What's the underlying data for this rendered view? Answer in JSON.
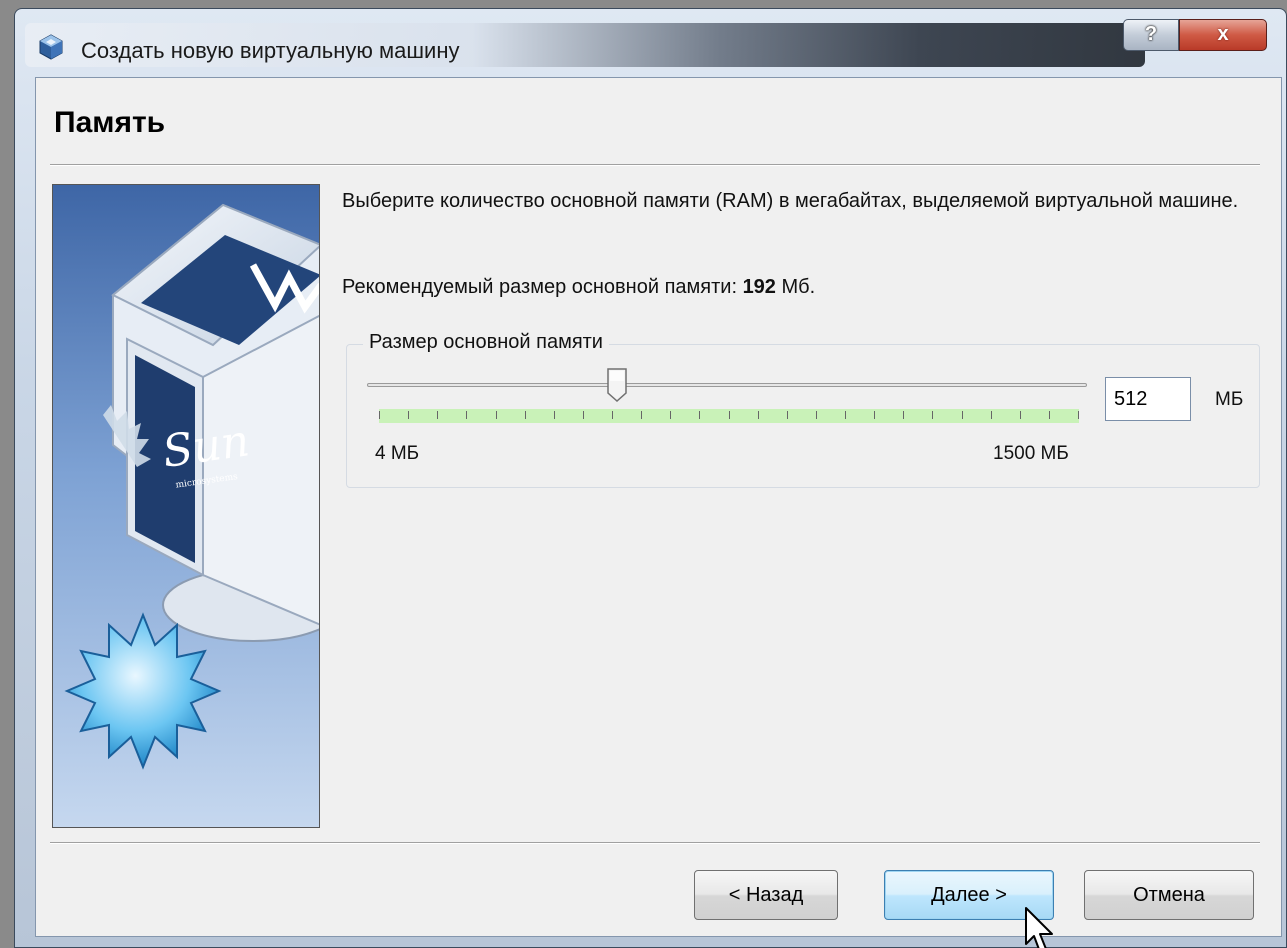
{
  "window": {
    "title": "Создать новую виртуальную машину",
    "help_label": "?",
    "close_label": "x"
  },
  "page": {
    "title": "Память",
    "description": "Выберите количество основной памяти (RAM) в мегабайтах, выделяемой виртуальной машине.",
    "recommend_prefix": "Рекомендуемый размер основной памяти: ",
    "recommend_value": "192",
    "recommend_suffix": " Мб."
  },
  "memory": {
    "group_label": "Размер основной памяти",
    "value": "512",
    "unit": "МБ",
    "min_label": "4 МБ",
    "max_label": "1500 МБ",
    "min_mb": 4,
    "max_mb": 1500,
    "tick_count": 25
  },
  "side_image": {
    "brand_text": "Sun",
    "brand_sub": "microsystems"
  },
  "buttons": {
    "back": "< Назад",
    "next": "Далее >",
    "cancel": "Отмена"
  },
  "colors": {
    "tick_band": "#c9f2b8",
    "default_button_border": "#3c7fb1"
  }
}
